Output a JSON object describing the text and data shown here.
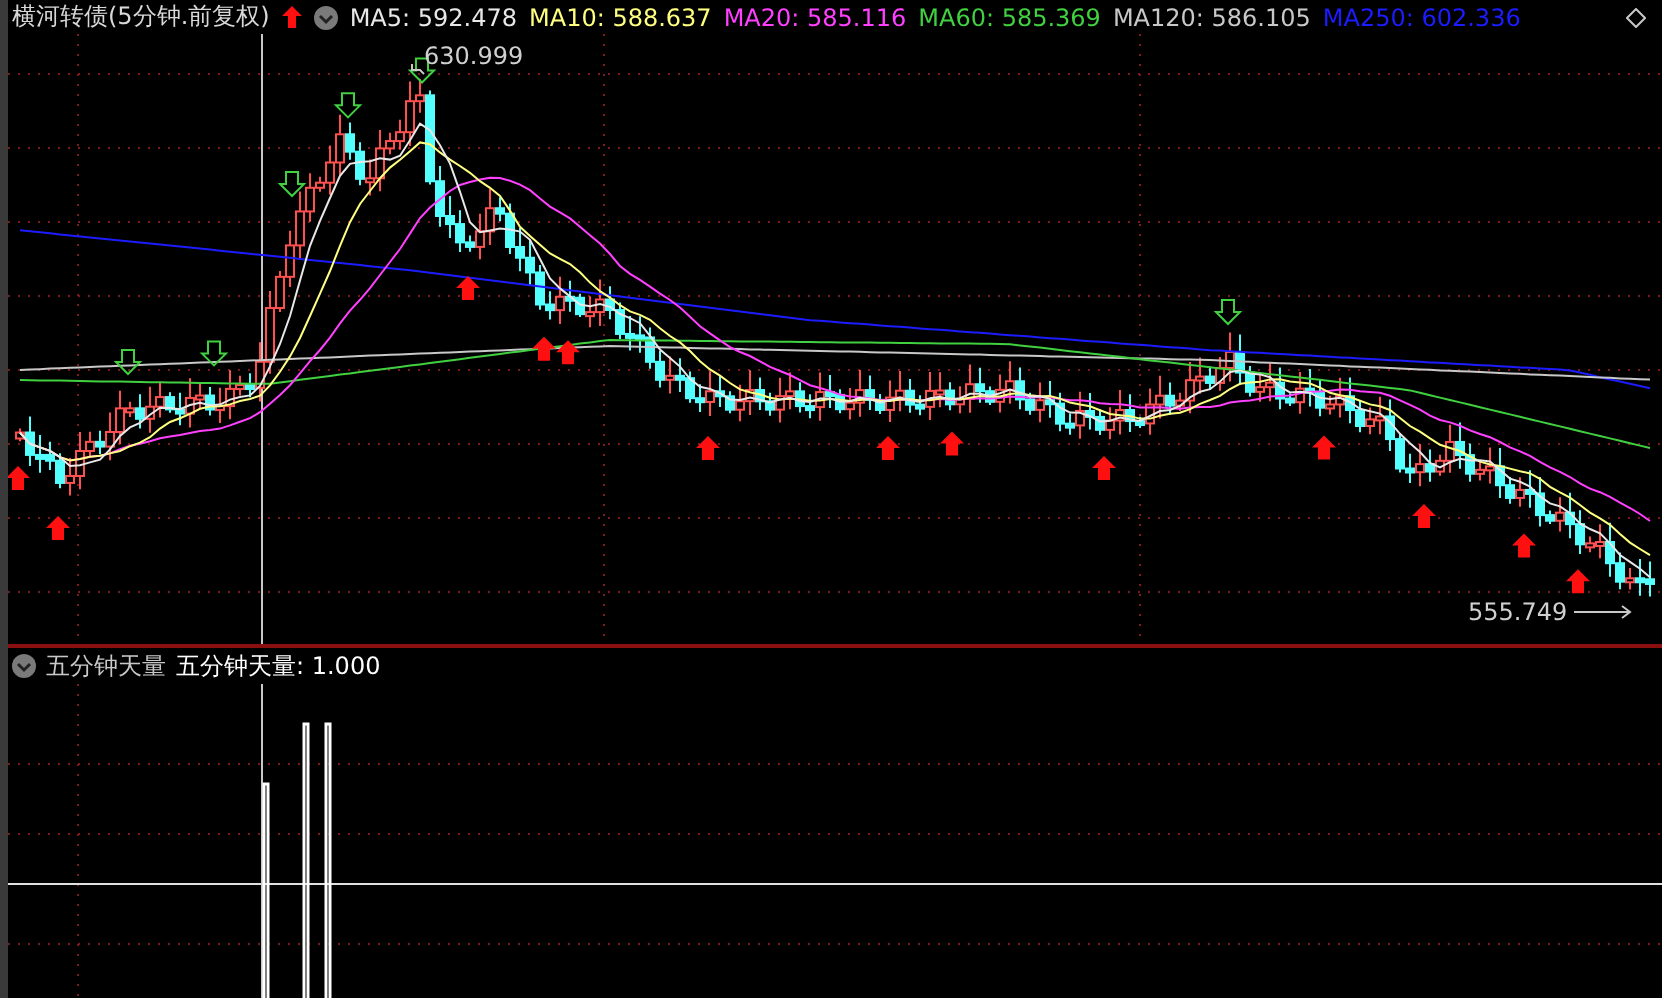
{
  "header": {
    "title": "横河转债(5分钟.前复权)",
    "legend": [
      {
        "label": "MA5: 592.478",
        "color": "#e8e8e8"
      },
      {
        "label": "MA10: 588.637",
        "color": "#ffff80"
      },
      {
        "label": "MA20: 585.116",
        "color": "#ff40ff"
      },
      {
        "label": "MA60: 585.369",
        "color": "#40d040"
      },
      {
        "label": "MA120: 586.105",
        "color": "#c8c8c8"
      },
      {
        "label": "MA250: 602.336",
        "color": "#1c1cff"
      }
    ]
  },
  "main_chart": {
    "high_label": "630.999",
    "low_label": "555.749"
  },
  "indicator": {
    "name": "五分钟天量",
    "value_label": "五分钟天量: 1.000"
  }
}
